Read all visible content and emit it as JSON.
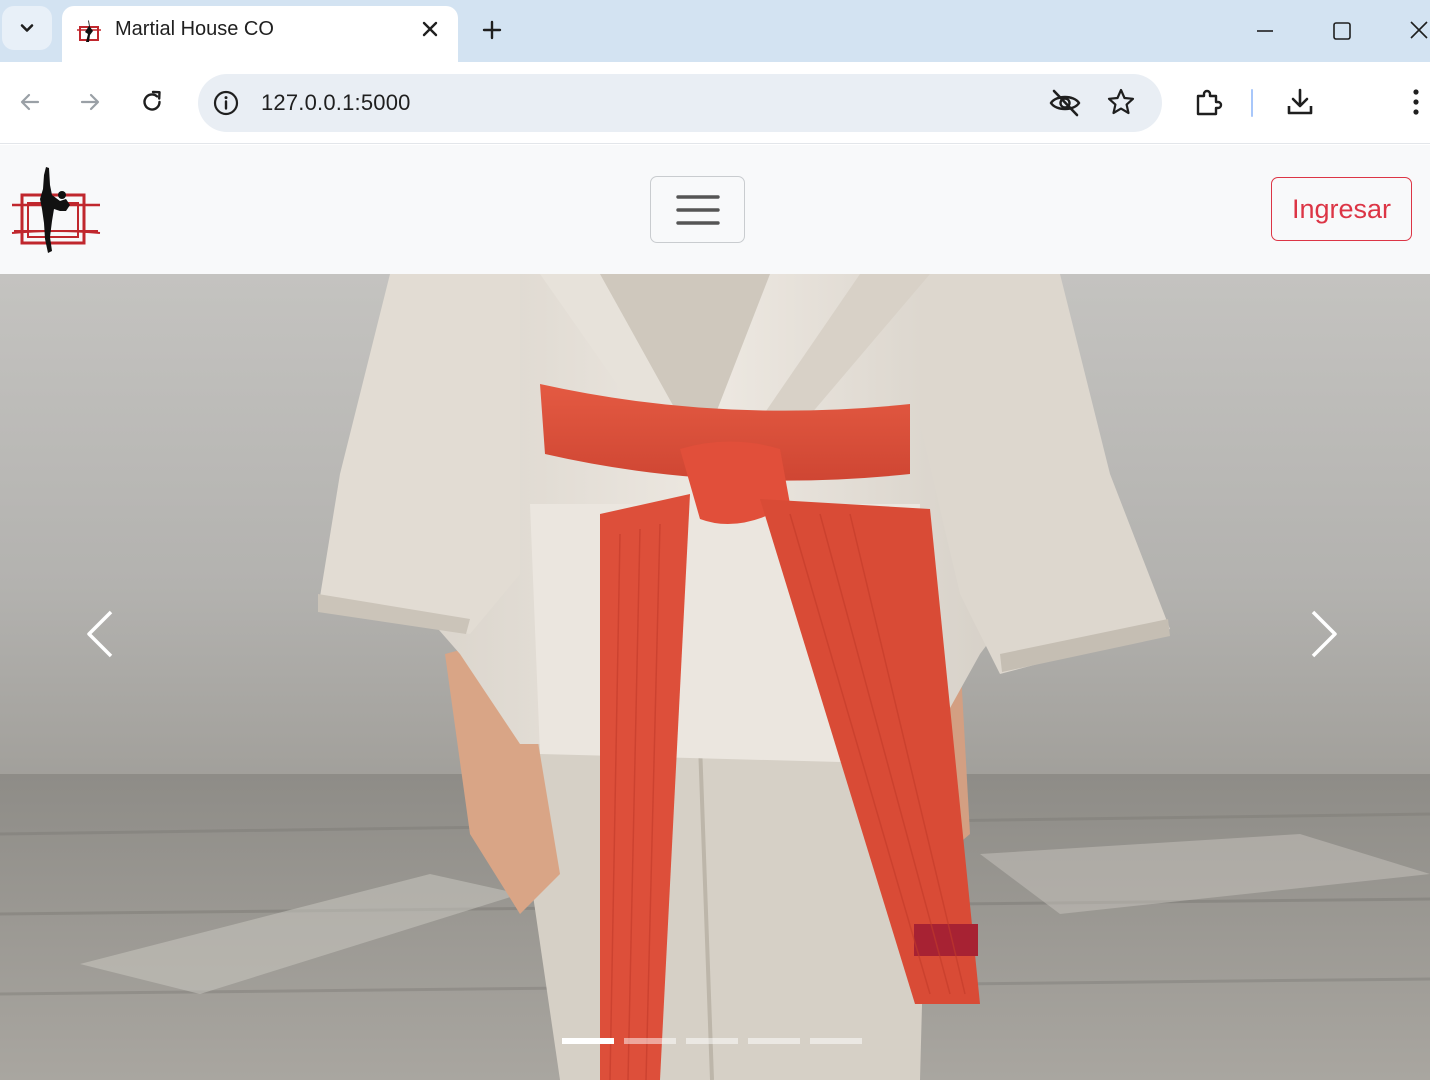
{
  "browser": {
    "tab": {
      "title": "Martial House CO",
      "favicon": "martial-logo-icon"
    },
    "address": {
      "url": "127.0.0.1:5000"
    },
    "icons": {
      "tab_search": "chevron-down-icon",
      "new_tab": "plus-icon",
      "back": "arrow-left-icon",
      "forward": "arrow-right-icon",
      "reload": "reload-icon",
      "site_info": "info-icon",
      "tracking": "eye-off-icon",
      "bookmark": "star-icon",
      "extensions": "puzzle-icon",
      "downloads": "download-icon",
      "menu": "more-vertical-icon"
    }
  },
  "navbar": {
    "logo": "martial-house-logo",
    "toggler_icon": "hamburger-icon",
    "login_label": "Ingresar"
  },
  "carousel": {
    "slide_image": "karate gi with red belt",
    "prev_icon": "chevron-left-icon",
    "next_icon": "chevron-right-icon",
    "slide_count": 5,
    "active_slide": 1
  },
  "colors": {
    "tabstrip": "#d3e3f2",
    "omnibox": "#e9eef4",
    "navbar": "#f8f9fa",
    "accent": "#dc3545",
    "belt": "#e8553f"
  }
}
